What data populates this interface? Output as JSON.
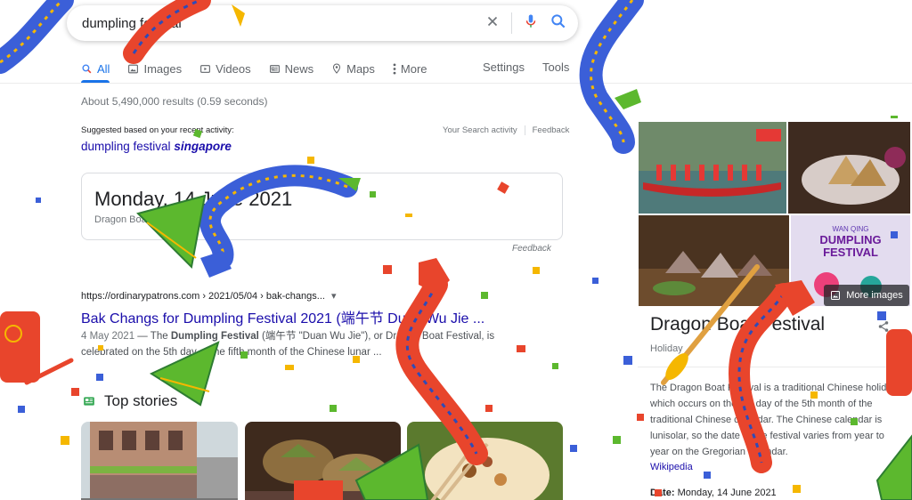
{
  "search": {
    "query": "dumpling festival"
  },
  "tabs": [
    {
      "label": "All"
    },
    {
      "label": "Images"
    },
    {
      "label": "Videos"
    },
    {
      "label": "News"
    },
    {
      "label": "Maps"
    },
    {
      "label": "More"
    }
  ],
  "tools": {
    "settings": "Settings",
    "tools": "Tools"
  },
  "result_stats": "About 5,490,000 results (0.59 seconds)",
  "suggestion": {
    "label": "Suggested based on your recent activity:",
    "prefix": "dumpling festival",
    "bold": "singapore",
    "activity_link": "Your Search activity",
    "feedback_link": "Feedback"
  },
  "date_card": {
    "date": "Monday, 14 June 2021",
    "caption": "Dragon Boat Festival"
  },
  "card_feedback": "Feedback",
  "result": {
    "url": "https://ordinarypatrons.com › 2021/05/04 › bak-changs...",
    "title": "Bak Changs for Dumpling Festival 2021 (端午节 Duan Wu Jie ...",
    "date": "4 May 2021",
    "snippet_1": " — The ",
    "snippet_bold": "Dumpling Festival",
    "snippet_2": " (端午节 \"Duan Wu Jie\"), or Dragon Boat Festival, is celebrated on the 5th day of the fifth month of the Chinese lunar ..."
  },
  "top_stories": "Top stories",
  "knowledge_panel": {
    "more_images": "More images",
    "title": "Dragon Boat Festival",
    "subtitle": "Holiday",
    "description": "The Dragon Boat Festival is a traditional Chinese holiday which occurs on the 5th day of the 5th month of the traditional Chinese calendar. The Chinese calendar is lunisolar, so the date of the festival varies from year to year on the Gregorian calendar.",
    "source": "Wikipedia",
    "date_label": "Date:",
    "date_value": " Monday, 14 June 2021"
  },
  "colors": {
    "link": "#1a0dab",
    "accent": "#1a73e8",
    "dragon_red": "#e8452c",
    "dragon_blue": "#3b5fd8",
    "zongzi_green": "#5cb82e"
  },
  "icons": [
    "clear-icon",
    "mic-icon",
    "search-icon",
    "images-tab-icon",
    "videos-tab-icon",
    "news-tab-icon",
    "maps-tab-icon",
    "more-dots-icon",
    "newspaper-icon",
    "share-icon",
    "dragon-decoration-icon",
    "zongzi-decoration-icon",
    "paddle-decoration-icon",
    "confetti-decoration"
  ]
}
